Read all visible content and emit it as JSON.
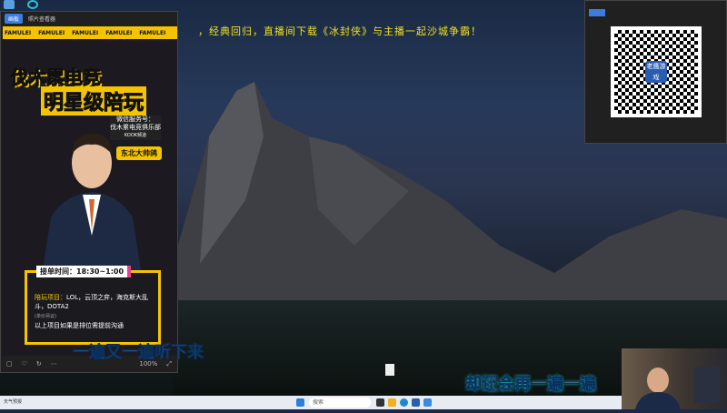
{
  "banner": "，经典回归，直播间下载《冰封侠》与主播一起沙城争霸！",
  "viewer": {
    "badge": "画板",
    "title": "照片查看器",
    "strip": [
      "FAMULEI",
      "FAMULEI",
      "FAMULEI",
      "FAMULEI",
      "FAMULEI"
    ],
    "poster": {
      "title1": "伐木累电竞",
      "title2": "明星级陪玩",
      "sub1": "微信服务号：",
      "sub2": "伐木累电竞俱乐部",
      "sub3": "KOOK频道",
      "tag": "东北大帅鸽",
      "hours": "接单时间：18:30~1:00",
      "games_label": "陪玩项目：",
      "games": "LOL，云顶之弈，海克斯大乱斗，DOTA2",
      "note_small": "(单价另议)",
      "note": "以上项目如果是排位需提前沟通"
    },
    "zoom": "100%"
  },
  "lyrics": {
    "left": "一遍又一遍听下来",
    "right": "却还会再一遍一遍"
  },
  "taskbar": {
    "search_placeholder": "搜索",
    "left_app": "天气预报"
  },
  "qr": {
    "logo": "老鹰游戏"
  },
  "accent": "#f5c400"
}
